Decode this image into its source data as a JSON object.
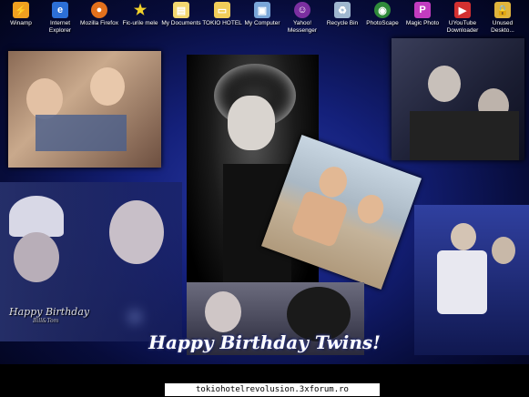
{
  "desktop": {
    "icons": [
      {
        "label": "Winamp",
        "icon": "winamp-icon",
        "color": "#f0a020"
      },
      {
        "label": "Internet\nExplorer",
        "icon": "internet-explorer-icon",
        "color": "#2c6fd6"
      },
      {
        "label": "Mozilla Firefox",
        "icon": "firefox-icon",
        "color": "#e2701c"
      },
      {
        "label": "Fic-urile mele",
        "icon": "star-icon",
        "color": "#f2d22a"
      },
      {
        "label": "My Documents",
        "icon": "my-documents-icon",
        "color": "#f3d870"
      },
      {
        "label": "TOKIO HOTEL",
        "icon": "folder-icon",
        "color": "#f1cd5a"
      },
      {
        "label": "My Computer",
        "icon": "my-computer-icon",
        "color": "#7aa6d8"
      },
      {
        "label": "Yahoo!\nMessenger",
        "icon": "yahoo-messenger-icon",
        "color": "#7b2fa0"
      },
      {
        "label": "Recycle Bin",
        "icon": "recycle-bin-icon",
        "color": "#9fb7cf"
      },
      {
        "label": "PhotoScape",
        "icon": "photoscape-icon",
        "color": "#2f8a3a"
      },
      {
        "label": "Magic Photo",
        "icon": "magic-photo-icon",
        "color": "#c23cc0"
      },
      {
        "label": "UYouTube\nDownloader",
        "icon": "youtube-downloader-icon",
        "color": "#d33030"
      },
      {
        "label": "Unused\nDeskto...",
        "icon": "lock-icon",
        "color": "#e0b43c"
      }
    ]
  },
  "wallpaper": {
    "caption": "Happy Birthday Twins!",
    "collage_caption_line1": "Happy Birthday",
    "collage_caption_line2": "Bill&Tom"
  },
  "footer": {
    "url": "tokiohotelrevolusion.3xforum.ro"
  }
}
